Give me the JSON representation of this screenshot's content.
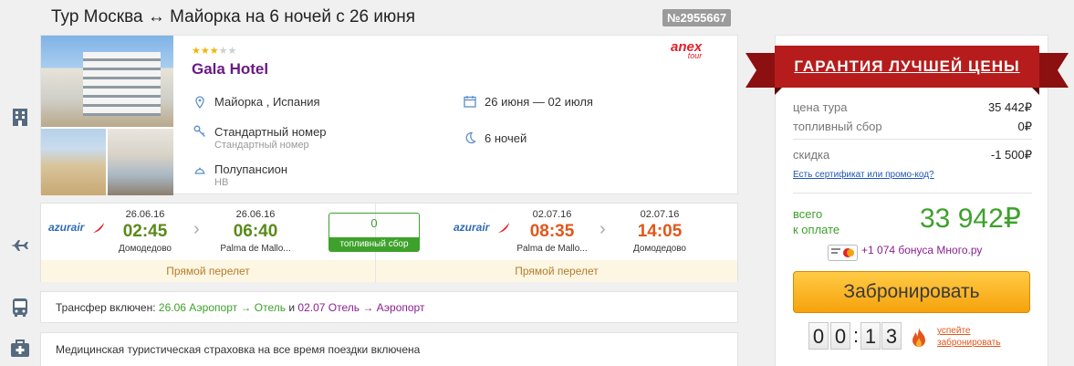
{
  "header": {
    "title": "Тур Москва ↔ Майорка на 6 ночей с 26 июня",
    "tour_id": "№2955667"
  },
  "hotel": {
    "stars_filled": 3,
    "stars_total": 5,
    "name": "Gala Hotel",
    "operator_logo_line1": "anex",
    "operator_logo_line2": "tour",
    "location": "Майорка , Испания",
    "dates": "26 июня — 02 июля",
    "room": "Стандартный номер",
    "room_sub": "Стандартный номер",
    "nights": "6 ночей",
    "meal": "Полупансион",
    "meal_code": "HB"
  },
  "flights": {
    "outbound": {
      "airline": "azurair",
      "dep_date": "26.06.16",
      "dep_time": "02:45",
      "dep_airport": "Домодедово",
      "arr_date": "26.06.16",
      "arr_time": "06:40",
      "arr_airport": "Palma de Mallo...",
      "type": "Прямой перелет"
    },
    "fuel": {
      "value": "0",
      "label": "топливный сбор"
    },
    "inbound": {
      "airline": "azurair",
      "dep_date": "02.07.16",
      "dep_time": "08:35",
      "dep_airport": "Palma de Mallo...",
      "arr_date": "02.07.16",
      "arr_time": "14:05",
      "arr_airport": "Домодедово",
      "type": "Прямой перелет"
    }
  },
  "transfer": {
    "label": "Трансфер включен:",
    "leg1": "26.06 Аэропорт → Отель",
    "and": "и",
    "leg2": "02.07 Отель → Аэропорт"
  },
  "insurance": {
    "text": "Медицинская туристическая страховка на все время поездки включена"
  },
  "price": {
    "ribbon": "ГАРАНТИЯ ЛУЧШЕЙ ЦЕНЫ",
    "tour_price_label": "цена тура",
    "tour_price": "35 442₽",
    "fuel_label": "топливный сбор",
    "fuel_value": "0₽",
    "discount_label": "скидка",
    "discount_value": "-1 500₽",
    "promo_link": "Есть сертификат или промо-код?",
    "total_label_1": "всего",
    "total_label_2": "к оплате",
    "total": "33 942₽",
    "bonus": "+1 074 бонуса Много.ру",
    "book_button": "Забронировать",
    "timer": [
      "0",
      "0",
      "1",
      "3"
    ],
    "hurry_1": "успейте",
    "hurry_2": "забронировать"
  },
  "colors": {
    "accent_green": "#3da12b",
    "accent_purple": "#8b1f8f",
    "orange_time": "#e2561b",
    "ribbon_red": "#b71c1c",
    "button_orange": "#f6a20c"
  },
  "icons": [
    "hotel-icon",
    "plane-icon",
    "bus-icon",
    "medkit-icon",
    "location-pin-icon",
    "calendar-icon",
    "room-key-icon",
    "moon-icon",
    "meal-icon",
    "chevron-right-icon",
    "fire-icon"
  ]
}
